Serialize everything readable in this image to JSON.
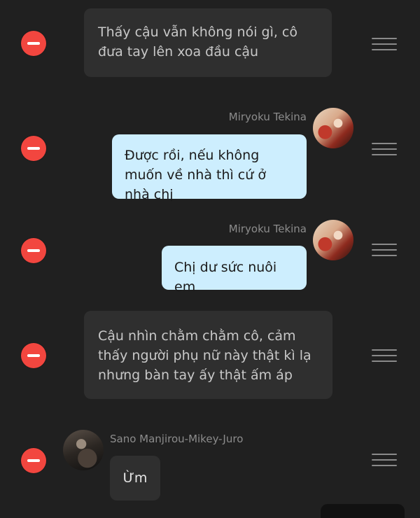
{
  "messages": [
    {
      "type": "narration",
      "text": "Thấy cậu vẫn không nói gì, cô đưa tay lên xoa đầu cậu"
    },
    {
      "type": "self",
      "sender": "Miryoku Tekina",
      "text": "Được rồi, nếu không muốn về nhà thì cứ ở nhà chị"
    },
    {
      "type": "self",
      "sender": "Miryoku Tekina",
      "text": "Chị dư sức nuôi em"
    },
    {
      "type": "narration",
      "text": "Cậu nhìn chằm chằm cô, cảm thấy người phụ nữ này thật kì lạ nhưng bàn tay ấy thật ấm áp"
    },
    {
      "type": "other",
      "sender": "Sano Manjirou-Mikey-Juro",
      "text": "Ừm"
    }
  ],
  "colors": {
    "background": "#202020",
    "delete_button": "#f2463f",
    "self_bubble": "#cdeefe",
    "narration_bubble": "#2f2f2f"
  },
  "icons": {
    "delete": "minus-circle-icon",
    "reorder": "drag-handle-icon"
  }
}
